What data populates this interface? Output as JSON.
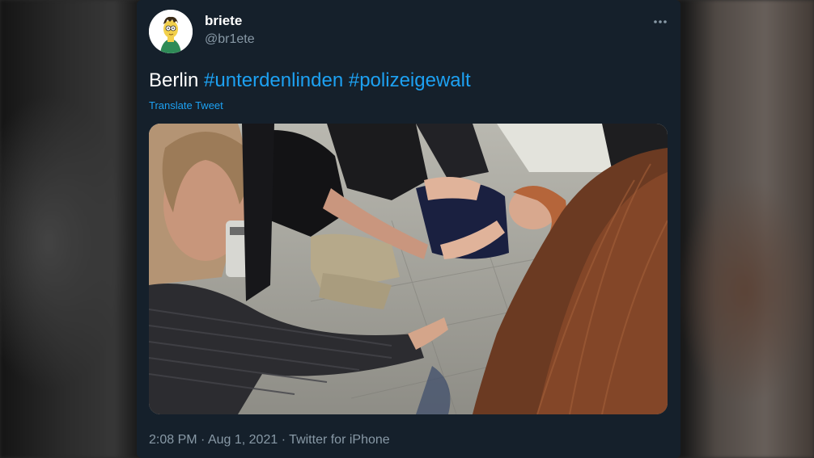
{
  "tweet": {
    "display_name": "briete",
    "handle": "@br1ete",
    "more_icon": "more-dots-icon",
    "text_plain": "Berlin",
    "hashtags": [
      "#unterdenlinden",
      "#polizeigewalt"
    ],
    "translate_label": "Translate Tweet",
    "time": "2:08 PM",
    "separator": "·",
    "date": "Aug 1, 2021",
    "source": "Twitter for iPhone"
  },
  "colors": {
    "background": "#15202b",
    "text_primary": "#ffffff",
    "text_secondary": "#8899a6",
    "accent": "#1da1f2"
  }
}
